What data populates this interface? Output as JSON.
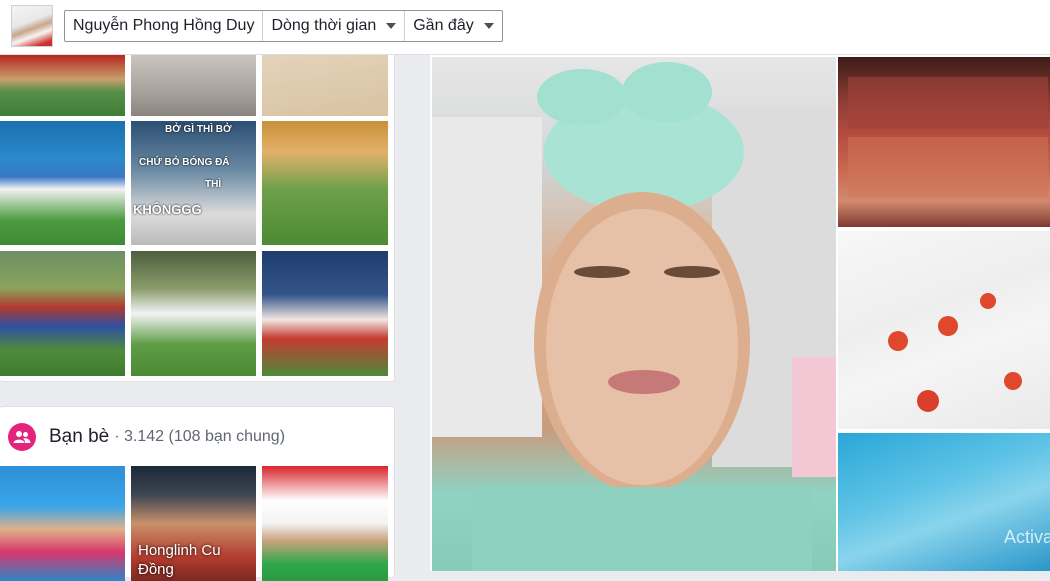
{
  "header": {
    "profile_name": "Nguyễn Phong Hồng Duy",
    "timeline_label": "Dòng thời gian",
    "recent_label": "Gần đây"
  },
  "photos": {
    "meme_text": [
      "BỞ GÌ THÌ BỞ",
      "CHỨ BỎ BÓNG ĐÁ",
      "THÌ",
      "KHÔNGGG"
    ]
  },
  "friends": {
    "title": "Bạn bè",
    "count": "3.142 (108 bạn chung)",
    "items": [
      {
        "name": ""
      },
      {
        "name": "Honglinh Cu\nĐồng"
      },
      {
        "name": ""
      }
    ]
  },
  "watermark": "Activa"
}
